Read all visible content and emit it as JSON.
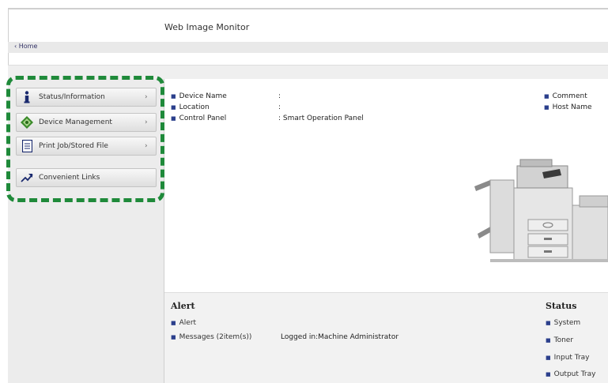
{
  "app": {
    "title": "Web Image Monitor"
  },
  "breadcrumb": {
    "home": "Home"
  },
  "sidebar": {
    "items": [
      {
        "label": "Status/Information",
        "icon": "info-icon"
      },
      {
        "label": "Device Management",
        "icon": "device-management-icon"
      },
      {
        "label": "Print Job/Stored File",
        "icon": "document-icon"
      },
      {
        "label": "Convenient Links",
        "icon": "link-arrow-icon"
      }
    ]
  },
  "device_info": {
    "rows": [
      {
        "label": "Device Name",
        "value": ":"
      },
      {
        "label": "Location",
        "value": ":"
      },
      {
        "label": "Control Panel",
        "value": ": Smart Operation Panel"
      }
    ],
    "right": [
      "Comment",
      "Host Name"
    ]
  },
  "alert": {
    "heading": "Alert",
    "items": [
      "Alert",
      "Messages (2item(s))"
    ],
    "logged_in": "Logged in:Machine Administrator"
  },
  "status": {
    "heading": "Status",
    "items": [
      "System",
      "Toner",
      "Input Tray",
      "Output Tray"
    ]
  },
  "colors": {
    "highlight": "#1f8a3a",
    "bullet": "#2b3f8c"
  }
}
